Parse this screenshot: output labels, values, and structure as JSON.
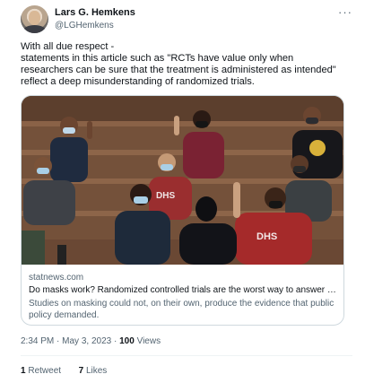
{
  "author": {
    "name": "Lars G. Hemkens",
    "handle": "@LGHemkens"
  },
  "menu": {
    "more_glyph": "···"
  },
  "tweet": {
    "lines": [
      "With all due respect -",
      "statements in this article such as \"RCTs have value only when",
      "researchers can be sure that the treatment is administered as intended\"",
      "reflect a deep misunderstanding of randomized trials."
    ]
  },
  "card": {
    "domain": "statnews.com",
    "title": "Do masks work? Randomized controlled trials are the worst way to answer th...",
    "description_lines": [
      "Studies on masking could not, on their own, produce the evidence that public",
      "policy demanded."
    ],
    "image_alt": "Students wearing face masks in a lecture hall, one raising a hand",
    "shirt_texts": [
      "DHS",
      "DHS"
    ]
  },
  "meta": {
    "time": "2:34 PM",
    "date": "May 3, 2023",
    "views_count": "100",
    "views_label": "Views",
    "separator": "·"
  },
  "stats": {
    "retweets_count": "1",
    "retweets_label": "Retweet",
    "likes_count": "7",
    "likes_label": "Likes"
  }
}
